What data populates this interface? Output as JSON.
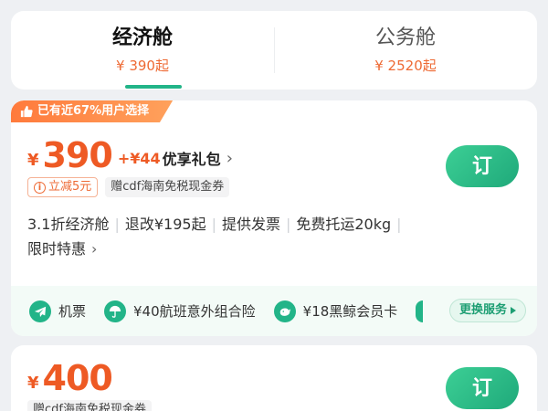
{
  "tabs": [
    {
      "name": "经济舱",
      "price": "¥ 390起",
      "active": true
    },
    {
      "name": "公务舱",
      "price": "¥ 2520起",
      "active": false
    }
  ],
  "fares": [
    {
      "popular_tag": "已有近67%用户选择",
      "currency": "¥",
      "price": "390",
      "bundle_plus": "+¥44",
      "bundle_text": "优享礼包",
      "discount": "立减5元",
      "gift": "赠cdf海南免税现金券",
      "book_label": "订",
      "features": [
        "3.1折经济舱",
        "退改¥195起",
        "提供发票",
        "免费托运20kg",
        "限时特惠"
      ],
      "services": [
        {
          "icon": "plane-icon",
          "label": "机票"
        },
        {
          "icon": "umbrella-icon",
          "label": "¥40航班意外组合险"
        },
        {
          "icon": "whale-icon",
          "label": "¥18黑鲸会员卡"
        }
      ],
      "change_service_label": "更换服务"
    },
    {
      "currency": "¥",
      "price": "400",
      "gift": "赠cdf海南免税现金券",
      "book_label": "订"
    }
  ],
  "colors": {
    "accent": "#22b488",
    "price": "#ee5a24",
    "tag_orange": "#ff7a3c"
  }
}
